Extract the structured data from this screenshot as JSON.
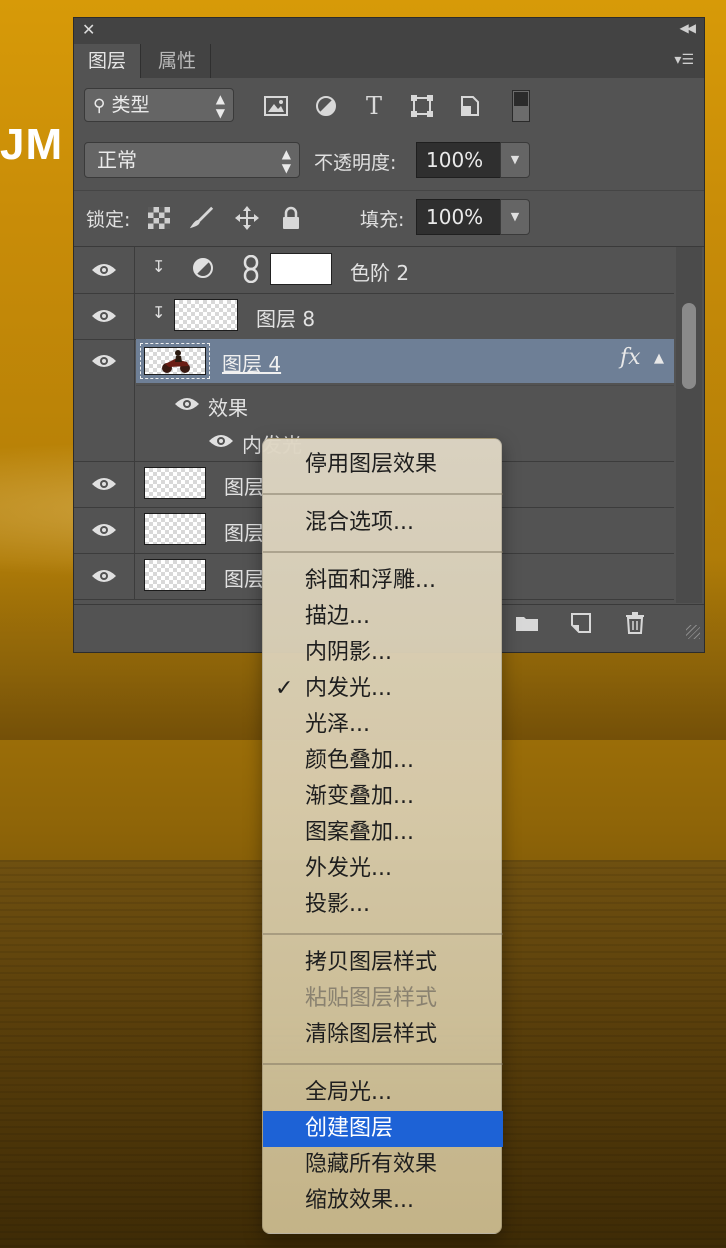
{
  "background": {
    "partial_text": "JM"
  },
  "panel": {
    "tabs": [
      {
        "label": "图层"
      },
      {
        "label": "属性"
      }
    ],
    "filter": {
      "label": "类型",
      "icons": [
        "image-filter-icon",
        "adjustment-filter-icon",
        "text-filter-icon",
        "shape-filter-icon",
        "smart-object-filter-icon"
      ]
    },
    "blend_mode": "正常",
    "opacity": {
      "label": "不透明度:",
      "value": "100%"
    },
    "lock": {
      "label": "锁定:"
    },
    "fill": {
      "label": "填充:",
      "value": "100%"
    },
    "layers": [
      {
        "name": "色阶 2",
        "type": "adjustment",
        "clipped": true,
        "visible": true
      },
      {
        "name": "图层 8",
        "type": "pixel",
        "clipped": true,
        "visible": true
      },
      {
        "name": "图层 4",
        "type": "pixel",
        "selected": true,
        "visible": true,
        "fx": "fx"
      },
      {
        "name": "效果",
        "type": "effects-group"
      },
      {
        "name": "内发光",
        "type": "effect"
      },
      {
        "name": "图层",
        "type": "pixel",
        "visible": true
      },
      {
        "name": "图层",
        "type": "pixel",
        "visible": true
      },
      {
        "name": "图层",
        "type": "pixel",
        "visible": true
      }
    ]
  },
  "context_menu": {
    "groups": [
      [
        {
          "label": "停用图层效果"
        }
      ],
      [
        {
          "label": "混合选项..."
        }
      ],
      [
        {
          "label": "斜面和浮雕..."
        },
        {
          "label": "描边..."
        },
        {
          "label": "内阴影..."
        },
        {
          "label": "内发光...",
          "checked": true
        },
        {
          "label": "光泽..."
        },
        {
          "label": "颜色叠加..."
        },
        {
          "label": "渐变叠加..."
        },
        {
          "label": "图案叠加..."
        },
        {
          "label": "外发光..."
        },
        {
          "label": "投影..."
        }
      ],
      [
        {
          "label": "拷贝图层样式"
        },
        {
          "label": "粘贴图层样式",
          "disabled": true
        },
        {
          "label": "清除图层样式"
        }
      ],
      [
        {
          "label": "全局光..."
        },
        {
          "label": "创建图层",
          "highlighted": true
        },
        {
          "label": "隐藏所有效果"
        },
        {
          "label": "缩放效果..."
        }
      ]
    ],
    "check_glyph": "✓",
    "highlight_color": "#1d62d6"
  }
}
